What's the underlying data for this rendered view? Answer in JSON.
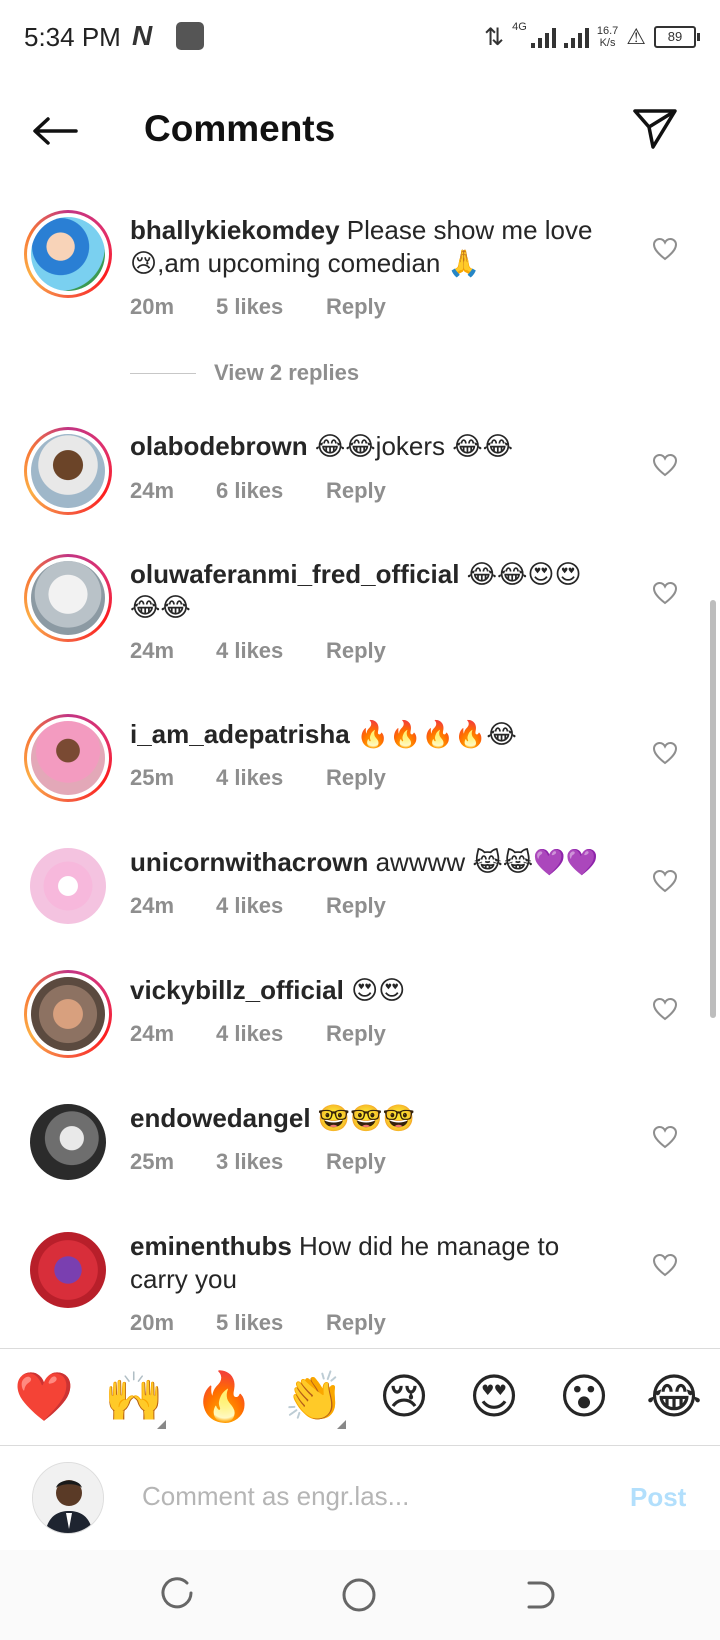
{
  "status_bar": {
    "time": "5:34 PM",
    "network": "4G",
    "speed_value": "16.7",
    "speed_unit": "K/s",
    "battery": "89"
  },
  "header": {
    "title": "Comments"
  },
  "comments": [
    {
      "username": "bhallykiekomdey",
      "text": "Please show me love 😢,am upcoming comedian 🙏",
      "time": "20m",
      "likes": "5 likes",
      "reply": "Reply",
      "view_replies": "View 2 replies"
    },
    {
      "username": "olabodebrown",
      "text": "😂😂jokers 😂😂",
      "time": "24m",
      "likes": "6 likes",
      "reply": "Reply"
    },
    {
      "username": "oluwaferanmi_fred_official",
      "text": "😂😂😍😍😂😂",
      "time": "24m",
      "likes": "4 likes",
      "reply": "Reply"
    },
    {
      "username": "i_am_adepatrisha",
      "text": "🔥🔥🔥🔥😂",
      "time": "25m",
      "likes": "4 likes",
      "reply": "Reply"
    },
    {
      "username": "unicornwithacrown",
      "text": "awwww 😹😹💜💜",
      "time": "24m",
      "likes": "4 likes",
      "reply": "Reply"
    },
    {
      "username": "vickybillz_official",
      "text": "😍😍",
      "time": "24m",
      "likes": "4 likes",
      "reply": "Reply"
    },
    {
      "username": "endowedangel",
      "text": "🤓🤓🤓",
      "time": "25m",
      "likes": "3 likes",
      "reply": "Reply"
    },
    {
      "username": "eminenthubs",
      "text": "How did he manage to carry you",
      "time": "20m",
      "likes": "5 likes",
      "reply": "Reply"
    }
  ],
  "emoji_bar": [
    "❤️",
    "🙌",
    "🔥",
    "👏",
    "😢",
    "😍",
    "😮",
    "😂"
  ],
  "composer": {
    "placeholder": "Comment as engr.las...",
    "post_label": "Post"
  },
  "colors": {
    "post_disabled": "#b2dffc",
    "meta_gray": "#8e8e8e",
    "text": "#262626"
  }
}
